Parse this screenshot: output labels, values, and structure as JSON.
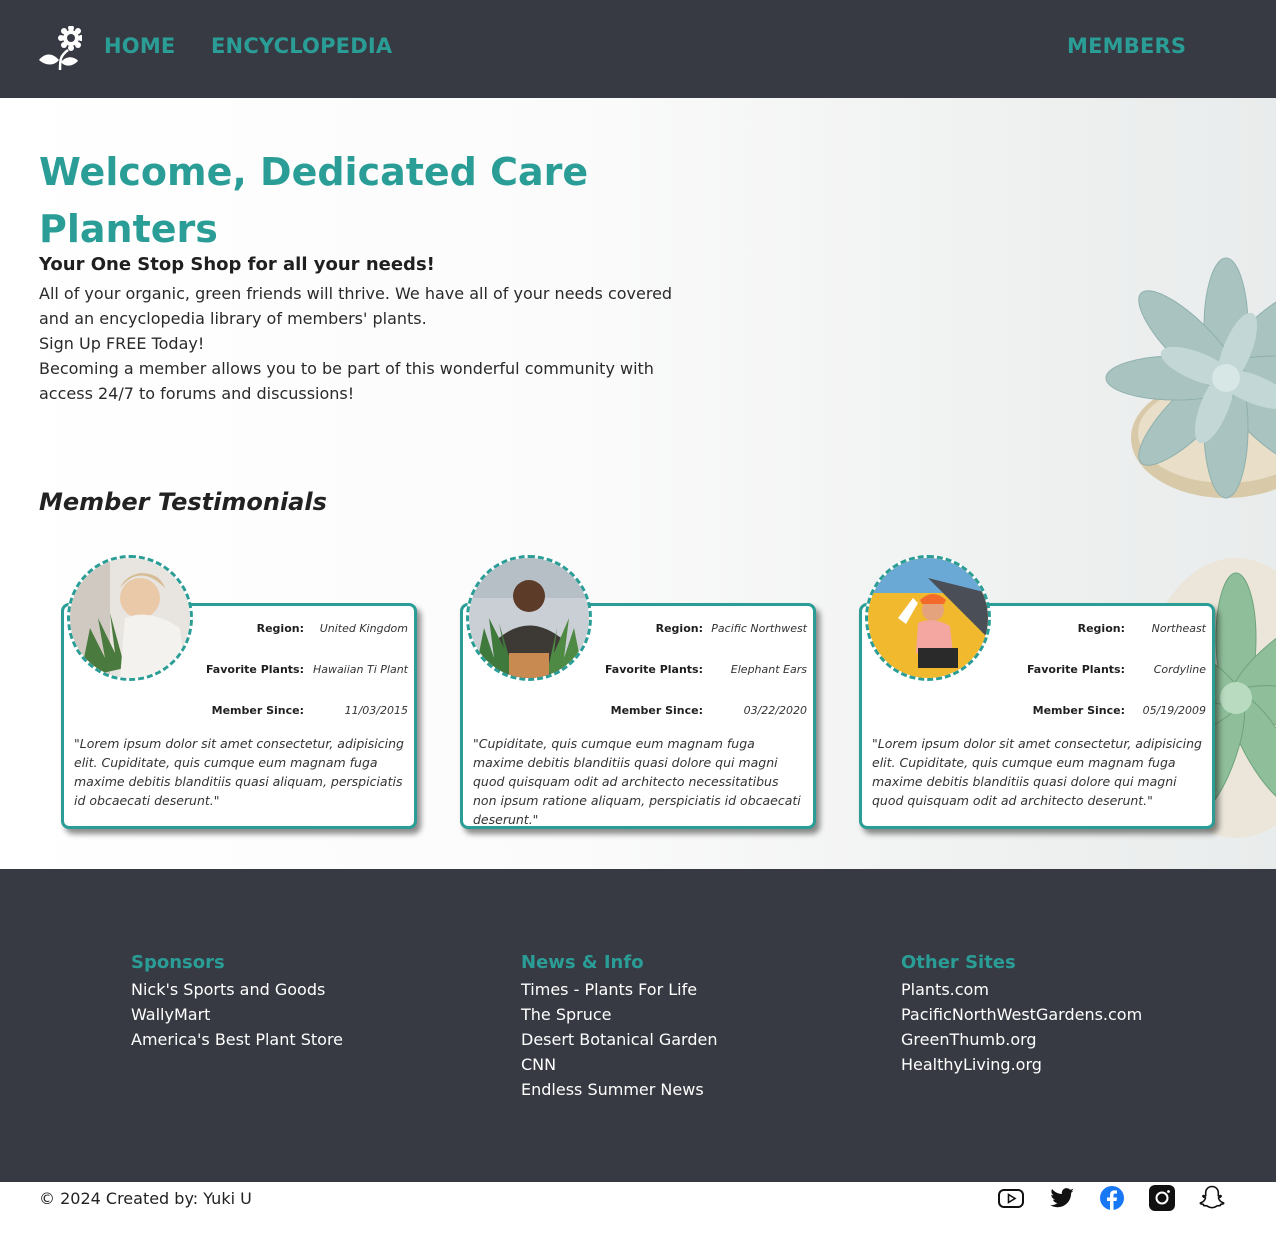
{
  "nav": {
    "home": "HOME",
    "encyclopedia": "ENCYCLOPEDIA",
    "members": "MEMBERS",
    "logo_icon": "flower-plant-icon"
  },
  "hero": {
    "title": "Welcome, Dedicated Care Planters",
    "subtitle": "Your One Stop Shop for all your needs!",
    "line1": "All of your organic, green friends will thrive. We have all of your needs covered and an encyclopedia library of members' plants.",
    "line2": "Sign Up FREE Today!",
    "line3": "Becoming a member allows you to be part of this wonderful community with access 24/7 to forums and discussions!"
  },
  "testimonials": {
    "heading": "Member Testimonials",
    "labels": {
      "region": "Region:",
      "favorite": "Favorite Plants:",
      "since": "Member Since:"
    },
    "cards": [
      {
        "region": "United Kingdom",
        "favorite": "Hawaiian Ti Plant",
        "since": "11/03/2015",
        "quote": "\"Lorem ipsum dolor sit amet consectetur, adipisicing elit. Cupiditate, quis cumque eum magnam fuga maxime debitis blanditiis quasi aliquam, perspiciatis id obcaecati deserunt.\""
      },
      {
        "region": "Pacific Northwest",
        "favorite": "Elephant Ears",
        "since": "03/22/2020",
        "quote": "\"Cupiditate, quis cumque eum magnam fuga maxime debitis blanditiis quasi dolore qui magni quod quisquam odit ad architecto necessitatibus non ipsum ratione aliquam, perspiciatis id obcaecati deserunt.\""
      },
      {
        "region": "Northeast",
        "favorite": "Cordyline",
        "since": "05/19/2009",
        "quote": "\"Lorem ipsum dolor sit amet consectetur, adipisicing elit. Cupiditate, quis cumque eum magnam fuga maxime debitis blanditiis quasi dolore qui magni quod quisquam odit ad architecto deserunt.\""
      }
    ]
  },
  "footer": {
    "sponsors": {
      "heading": "Sponsors",
      "links": [
        "Nick's Sports and Goods",
        "WallyMart",
        "America's Best Plant Store"
      ]
    },
    "news": {
      "heading": "News & Info",
      "links": [
        "Times - Plants For Life",
        "The Spruce",
        "Desert Botanical Garden",
        "CNN",
        "Endless Summer News"
      ]
    },
    "other": {
      "heading": "Other Sites",
      "links": [
        "Plants.com",
        "PacificNorthWestGardens.com",
        "GreenThumb.org",
        "HealthyLiving.org"
      ]
    }
  },
  "copyright": "© 2024 Created by: Yuki U",
  "social": [
    "youtube-icon",
    "twitter-icon",
    "facebook-icon",
    "instagram-icon",
    "snapchat-icon"
  ],
  "colors": {
    "accent": "#2a9d96",
    "dark": "#373a42",
    "facebook": "#1877f2"
  }
}
